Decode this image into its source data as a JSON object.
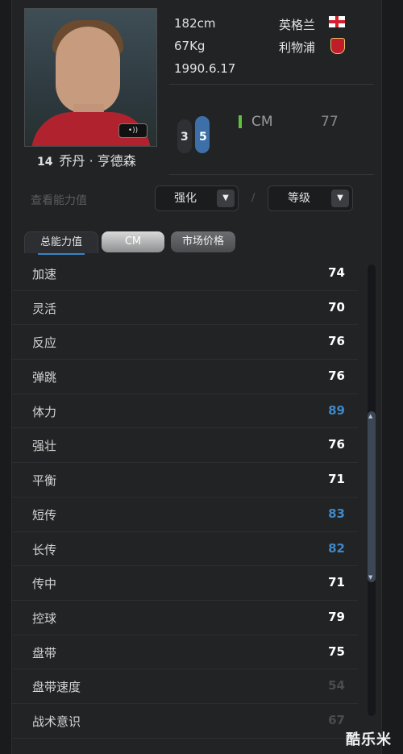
{
  "player": {
    "number": "14",
    "name": "乔丹 · 亨德森",
    "height": "182cm",
    "weight": "67Kg",
    "birthdate": "1990.6.17",
    "nation": "英格兰",
    "club": "利物浦",
    "voice_icon": "speaker-icon"
  },
  "position": {
    "foot_left": "3",
    "foot_right": "5",
    "label": "CM",
    "rating": "77",
    "accent": "#5fc23a"
  },
  "controls": {
    "view_label": "查看能力值",
    "enhance": "强化",
    "separator": "/",
    "level": "等级"
  },
  "tabs": [
    "总能力值",
    "CM",
    "市场价格"
  ],
  "stats": [
    {
      "name": "加速",
      "value": "74",
      "color": "#ffffff"
    },
    {
      "name": "灵活",
      "value": "70",
      "color": "#ffffff"
    },
    {
      "name": "反应",
      "value": "76",
      "color": "#ffffff"
    },
    {
      "name": "弹跳",
      "value": "76",
      "color": "#ffffff"
    },
    {
      "name": "体力",
      "value": "89",
      "color": "#3f88c8"
    },
    {
      "name": "强壮",
      "value": "76",
      "color": "#ffffff"
    },
    {
      "name": "平衡",
      "value": "71",
      "color": "#ffffff"
    },
    {
      "name": "短传",
      "value": "83",
      "color": "#3f88c8"
    },
    {
      "name": "长传",
      "value": "82",
      "color": "#3f88c8"
    },
    {
      "name": "传中",
      "value": "71",
      "color": "#ffffff"
    },
    {
      "name": "控球",
      "value": "79",
      "color": "#ffffff"
    },
    {
      "name": "盘带",
      "value": "75",
      "color": "#ffffff"
    },
    {
      "name": "盘带速度",
      "value": "54",
      "color": "#4b4c4f"
    },
    {
      "name": "战术意识",
      "value": "67",
      "color": "#4b4c4f"
    }
  ],
  "watermark": "酷乐米"
}
